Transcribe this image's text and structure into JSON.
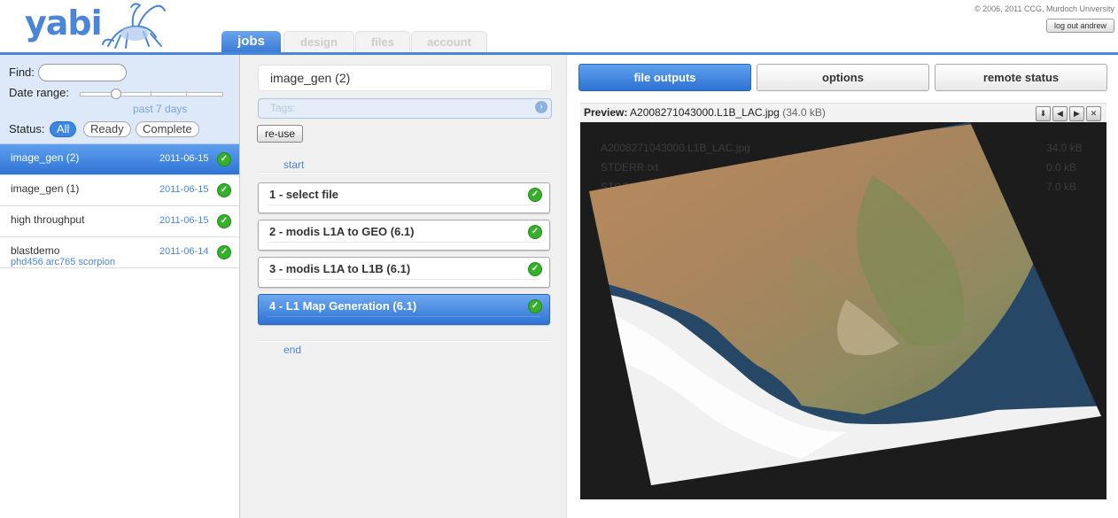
{
  "app": {
    "logo_text": "yabi",
    "copyright": "© 2006, 2011 CCG, Murdoch University",
    "logout_label": "log out andrew"
  },
  "tabs": [
    {
      "label": "jobs",
      "active": true
    },
    {
      "label": "design",
      "active": false
    },
    {
      "label": "files",
      "active": false
    },
    {
      "label": "account",
      "active": false
    }
  ],
  "filters": {
    "find_label": "Find:",
    "find_value": "",
    "date_range_label": "Date range:",
    "date_range_value": "past 7 days",
    "status_label": "Status:",
    "status_options": [
      "All",
      "Ready",
      "Complete"
    ],
    "status_selected": "All"
  },
  "jobs": [
    {
      "name": "image_gen (2)",
      "date": "2011-06-15",
      "tags": "",
      "status": "complete",
      "selected": true
    },
    {
      "name": "image_gen (1)",
      "date": "2011-06-15",
      "tags": "",
      "status": "complete",
      "selected": false
    },
    {
      "name": "high throughput",
      "date": "2011-06-15",
      "tags": "",
      "status": "complete",
      "selected": false
    },
    {
      "name": "blastdemo",
      "date": "2011-06-14",
      "tags": "phd456 arc765 scorpion",
      "status": "complete",
      "selected": false
    }
  ],
  "workflow": {
    "title": "image_gen (2)",
    "tags_placeholder": "Tags:",
    "reuse_label": "re-use",
    "start_label": "start",
    "end_label": "end",
    "steps": [
      {
        "label": "1 - select file",
        "status": "complete",
        "active": false
      },
      {
        "label": "2 - modis L1A to GEO (6.1)",
        "status": "complete",
        "active": false
      },
      {
        "label": "3 - modis L1A to L1B (6.1)",
        "status": "complete",
        "active": false
      },
      {
        "label": "4 - L1 Map Generation (6.1)",
        "status": "complete",
        "active": true
      }
    ]
  },
  "detail": {
    "tabs": [
      "file outputs",
      "options",
      "remote status"
    ],
    "active_tab": "file outputs",
    "preview_label": "Preview:",
    "preview_file": "A2008271043000.L1B_LAC.jpg",
    "preview_size": "(34.0 kB)",
    "controls": [
      "download-icon",
      "prev-icon",
      "next-icon",
      "close-icon"
    ],
    "ghost_files": [
      {
        "name": "A2008271043000.L1B_LAC.jpg",
        "size": "34.0 kB"
      },
      {
        "name": "STDERR.txt",
        "size": "0.0 kB"
      },
      {
        "name": "STDOUT.txt",
        "size": "7.0 kB"
      }
    ]
  },
  "colors": {
    "accent": "#3a7bd5",
    "success": "#36b02a",
    "link": "#4a86d8"
  }
}
